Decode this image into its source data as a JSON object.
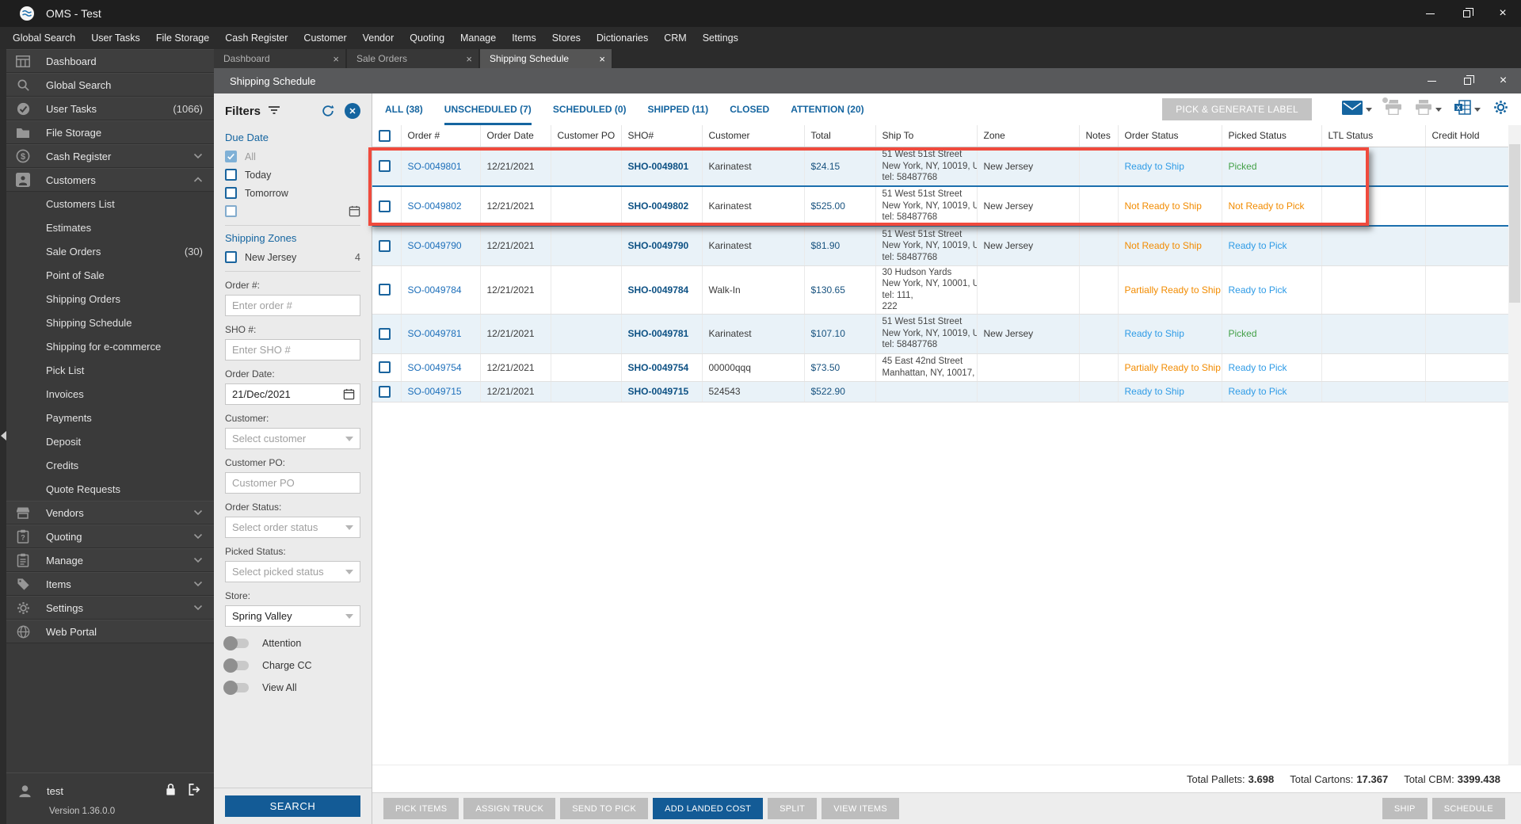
{
  "window": {
    "title": "OMS - Test"
  },
  "menu": {
    "items": [
      "Global Search",
      "User Tasks",
      "File Storage",
      "Cash Register",
      "Customer",
      "Vendor",
      "Quoting",
      "Manage",
      "Items",
      "Stores",
      "Dictionaries",
      "CRM",
      "Settings"
    ]
  },
  "doc_tabs": {
    "items": [
      "Dashboard",
      "Sale Orders",
      "Shipping Schedule"
    ]
  },
  "panel": {
    "title": "Shipping Schedule"
  },
  "sidebar": {
    "top": [
      {
        "label": "Dashboard",
        "count": ""
      },
      {
        "label": "Global Search",
        "count": ""
      },
      {
        "label": "User Tasks",
        "count": "(1066)"
      },
      {
        "label": "File Storage",
        "count": ""
      },
      {
        "label": "Cash Register",
        "count": ""
      },
      {
        "label": "Customers",
        "count": ""
      }
    ],
    "sub": [
      {
        "label": "Customers List",
        "count": ""
      },
      {
        "label": "Estimates",
        "count": ""
      },
      {
        "label": "Sale Orders",
        "count": "(30)"
      },
      {
        "label": "Point of Sale",
        "count": ""
      },
      {
        "label": "Shipping Orders",
        "count": ""
      },
      {
        "label": "Shipping Schedule",
        "count": ""
      },
      {
        "label": "Shipping for e-commerce",
        "count": ""
      },
      {
        "label": "Pick List",
        "count": ""
      },
      {
        "label": "Invoices",
        "count": ""
      },
      {
        "label": "Payments",
        "count": ""
      },
      {
        "label": "Deposit",
        "count": ""
      },
      {
        "label": "Credits",
        "count": ""
      },
      {
        "label": "Quote Requests",
        "count": ""
      }
    ],
    "bottom": [
      {
        "label": "Vendors"
      },
      {
        "label": "Quoting"
      },
      {
        "label": "Manage"
      },
      {
        "label": "Items"
      },
      {
        "label": "Settings"
      },
      {
        "label": "Web Portal"
      }
    ],
    "user": {
      "name": "test",
      "version": "Version 1.36.0.0"
    }
  },
  "filters": {
    "title": "Filters",
    "due_date": {
      "label": "Due Date",
      "options": [
        "All",
        "Today",
        "Tomorrow"
      ]
    },
    "shipping_zones": {
      "label": "Shipping Zones",
      "zone": "New Jersey",
      "zone_count": "4"
    },
    "order_no": {
      "label": "Order #:",
      "placeholder": "Enter order #"
    },
    "sho_no": {
      "label": "SHO #:",
      "placeholder": "Enter SHO #"
    },
    "order_date": {
      "label": "Order Date:",
      "value": "21/Dec/2021"
    },
    "customer": {
      "label": "Customer:",
      "placeholder": "Select customer"
    },
    "customer_po": {
      "label": "Customer PO:",
      "placeholder": "Customer PO"
    },
    "order_status": {
      "label": "Order Status:",
      "placeholder": "Select order status"
    },
    "picked_status": {
      "label": "Picked Status:",
      "placeholder": "Select picked status"
    },
    "store": {
      "label": "Store:",
      "value": "Spring Valley"
    },
    "toggles": [
      "Attention",
      "Charge CC",
      "View All"
    ],
    "search": "SEARCH"
  },
  "status_tabs": [
    "ALL (38)",
    "UNSCHEDULED (7)",
    "SCHEDULED (0)",
    "SHIPPED (11)",
    "CLOSED",
    "ATTENTION (20)"
  ],
  "toolbar": {
    "pick_generate": "PICK & GENERATE LABEL"
  },
  "table": {
    "columns": [
      "Order #",
      "Order Date",
      "Customer PO",
      "SHO#",
      "Customer",
      "Total",
      "Ship To",
      "Zone",
      "Notes",
      "Order Status",
      "Picked Status",
      "LTL Status",
      "Credit Hold"
    ],
    "rows": [
      {
        "order": "SO-0049801",
        "date": "12/21/2021",
        "po": "",
        "sho": "SHO-0049801",
        "customer": "Karinatest",
        "total": "$24.15",
        "ship": [
          "51 West 51st Street",
          "New York, NY, 10019, U",
          "tel: 58487768"
        ],
        "zone": "New Jersey",
        "notes": "",
        "ostatus": "Ready to Ship",
        "pstatus": "Picked",
        "ltl": "",
        "credit": ""
      },
      {
        "order": "SO-0049802",
        "date": "12/21/2021",
        "po": "",
        "sho": "SHO-0049802",
        "customer": "Karinatest",
        "total": "$525.00",
        "ship": [
          "51 West 51st Street",
          "New York, NY, 10019, U",
          "tel: 58487768"
        ],
        "zone": "New Jersey",
        "notes": "",
        "ostatus": "Not Ready to Ship",
        "pstatus": "Not Ready to Pick",
        "ltl": "",
        "credit": ""
      },
      {
        "order": "SO-0049790",
        "date": "12/21/2021",
        "po": "",
        "sho": "SHO-0049790",
        "customer": "Karinatest",
        "total": "$81.90",
        "ship": [
          "51 West 51st Street",
          "New York, NY, 10019, U",
          "tel: 58487768"
        ],
        "zone": "New Jersey",
        "notes": "",
        "ostatus": "Not Ready to Ship",
        "pstatus": "Ready to Pick",
        "ltl": "",
        "credit": ""
      },
      {
        "order": "SO-0049784",
        "date": "12/21/2021",
        "po": "",
        "sho": "SHO-0049784",
        "customer": "Walk-In",
        "total": "$130.65",
        "ship": [
          "30 Hudson Yards",
          "New York, NY, 10001, U",
          "tel: 111,",
          "222"
        ],
        "zone": "",
        "notes": "",
        "ostatus": "Partially Ready to Ship",
        "pstatus": "Ready to Pick",
        "ltl": "",
        "credit": ""
      },
      {
        "order": "SO-0049781",
        "date": "12/21/2021",
        "po": "",
        "sho": "SHO-0049781",
        "customer": "Karinatest",
        "total": "$107.10",
        "ship": [
          "51 West 51st Street",
          "New York, NY, 10019, U",
          "tel: 58487768"
        ],
        "zone": "New Jersey",
        "notes": "",
        "ostatus": "Ready to Ship",
        "pstatus": "Picked",
        "ltl": "",
        "credit": ""
      },
      {
        "order": "SO-0049754",
        "date": "12/21/2021",
        "po": "",
        "sho": "SHO-0049754",
        "customer": "00000qqq",
        "total": "$73.50",
        "ship": [
          "45 East 42nd Street",
          "Manhattan, NY, 10017,"
        ],
        "zone": "",
        "notes": "",
        "ostatus": "Partially Ready to Ship",
        "pstatus": "Ready to Pick",
        "ltl": "",
        "credit": ""
      },
      {
        "order": "SO-0049715",
        "date": "12/21/2021",
        "po": "",
        "sho": "SHO-0049715",
        "customer": "524543",
        "total": "$522.90",
        "ship": [],
        "zone": "",
        "notes": "",
        "ostatus": "Ready to Ship",
        "pstatus": "Ready to Pick",
        "ltl": "",
        "credit": ""
      }
    ]
  },
  "totals": {
    "pallets_label": "Total Pallets:",
    "pallets": "3.698",
    "cartons_label": "Total Cartons:",
    "cartons": "17.367",
    "cbm_label": "Total CBM:",
    "cbm": "3399.438"
  },
  "footer": {
    "left": [
      "PICK ITEMS",
      "ASSIGN TRUCK",
      "SEND TO PICK",
      "ADD LANDED COST",
      "SPLIT",
      "VIEW ITEMS"
    ],
    "right": [
      "SHIP",
      "SCHEDULE"
    ]
  },
  "colors": {
    "accent": "#135b96",
    "status_ready": "#2e9be6",
    "status_picked": "#43a047",
    "status_warning": "#f28b00",
    "highlight_box": "#f04a3d"
  }
}
